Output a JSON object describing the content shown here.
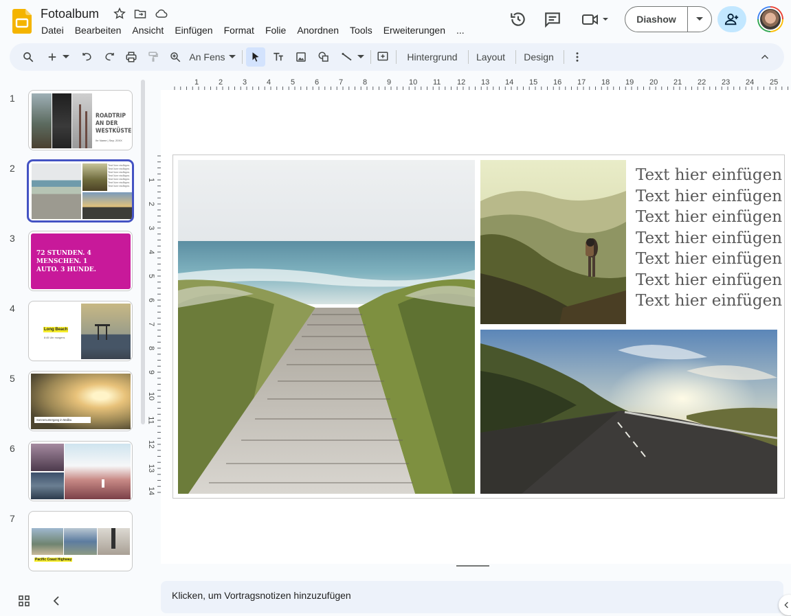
{
  "doc": {
    "title": "Fotoalbum"
  },
  "menu": [
    "Datei",
    "Bearbeiten",
    "Ansicht",
    "Einfügen",
    "Format",
    "Folie",
    "Anordnen",
    "Tools",
    "Erweiterungen",
    "..."
  ],
  "header": {
    "slideshow_label": "Diashow"
  },
  "toolbar": {
    "zoom_label": "An Fens",
    "background_label": "Hintergrund",
    "layout_label": "Layout",
    "design_label": "Design"
  },
  "ruler": {
    "h": [
      "1",
      "2",
      "3",
      "4",
      "5",
      "6",
      "7",
      "8",
      "9",
      "10",
      "11",
      "12",
      "13",
      "14",
      "15",
      "16",
      "17",
      "18",
      "19",
      "20",
      "21",
      "22",
      "23",
      "24",
      "25"
    ],
    "v": [
      "1",
      "2",
      "3",
      "4",
      "5",
      "6",
      "7",
      "8",
      "9",
      "10",
      "11",
      "12",
      "13",
      "14"
    ]
  },
  "slides": [
    {
      "num": "1",
      "title": "ROADTRIP AN DER WESTKÜSTE",
      "subtitle": "Ihr Name | Sep. 20XX"
    },
    {
      "num": "2",
      "caption": "Text hier einfügen"
    },
    {
      "num": "3",
      "title": "72 STUNDEN. 4 MENSCHEN. 1 AUTO. 3 HUNDE."
    },
    {
      "num": "4",
      "title": "Long Beach",
      "subtitle": "8:45 Uhr morgens"
    },
    {
      "num": "5",
      "caption": "Sonnenuntergang in Malibu"
    },
    {
      "num": "6"
    },
    {
      "num": "7",
      "caption": "Pacific Coast Highway"
    }
  ],
  "slide_text": [
    "Text hier einfügen",
    "Text hier einfügen",
    "Text hier einfügen",
    "Text hier einfügen",
    "Text hier einfügen",
    "Text hier einfügen",
    "Text hier einfügen"
  ],
  "notes": {
    "placeholder": "Klicken, um Vortragsnotizen hinzuzufügen"
  },
  "colors": {
    "accent": "#4453c3",
    "magenta": "#c8199a",
    "highlight": "#f5ec2b"
  }
}
